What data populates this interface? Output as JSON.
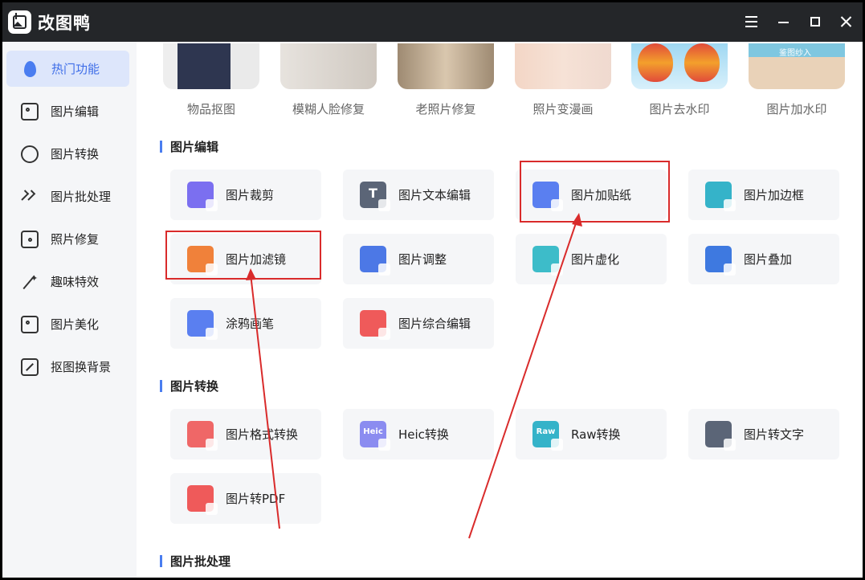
{
  "window": {
    "title": "改图鸭"
  },
  "sidebar": {
    "items": [
      {
        "label": "热门功能",
        "icon": "flame-icon",
        "active": true
      },
      {
        "label": "图片编辑",
        "icon": "image-edit-icon"
      },
      {
        "label": "图片转换",
        "icon": "convert-icon"
      },
      {
        "label": "图片批处理",
        "icon": "batch-icon"
      },
      {
        "label": "照片修复",
        "icon": "photo-repair-icon"
      },
      {
        "label": "趣味特效",
        "icon": "magic-wand-icon"
      },
      {
        "label": "图片美化",
        "icon": "beautify-icon"
      },
      {
        "label": "抠图换背景",
        "icon": "cutout-icon"
      }
    ]
  },
  "featured": [
    {
      "label": "物品抠图"
    },
    {
      "label": "模糊人脸修复"
    },
    {
      "label": "老照片修复"
    },
    {
      "label": "照片变漫画"
    },
    {
      "label": "图片去水印"
    },
    {
      "label": "图片加水印",
      "watermark": "鉴图纱入"
    }
  ],
  "sections": {
    "edit": {
      "title": "图片编辑",
      "cards": [
        {
          "label": "图片裁剪",
          "icon": "crop-icon",
          "color": "#7b6ff0"
        },
        {
          "label": "图片文本编辑",
          "icon": "text-edit-icon",
          "color": "#5b6577"
        },
        {
          "label": "图片加贴纸",
          "icon": "sticker-icon",
          "color": "#5a7ff0",
          "highlighted": true
        },
        {
          "label": "图片加边框",
          "icon": "border-icon",
          "color": "#35b3c9"
        },
        {
          "label": "图片加滤镜",
          "icon": "filter-icon",
          "color": "#f0813a",
          "highlighted": true
        },
        {
          "label": "图片调整",
          "icon": "adjust-icon",
          "color": "#4c78e6"
        },
        {
          "label": "图片虚化",
          "icon": "blur-icon",
          "color": "#3dbcc9"
        },
        {
          "label": "图片叠加",
          "icon": "layers-icon",
          "color": "#3e79e0"
        },
        {
          "label": "涂鸦画笔",
          "icon": "brush-icon",
          "color": "#5a7ff0"
        },
        {
          "label": "图片综合编辑",
          "icon": "comprehensive-edit-icon",
          "color": "#ef5a5a"
        }
      ]
    },
    "convert": {
      "title": "图片转换",
      "cards": [
        {
          "label": "图片格式转换",
          "icon": "format-convert-icon",
          "color": "#ef6767"
        },
        {
          "label": "Heic转换",
          "icon": "heic-icon",
          "color": "#8b8cf0",
          "glyph": "Heic"
        },
        {
          "label": "Raw转换",
          "icon": "raw-icon",
          "color": "#35b3c9",
          "glyph": "Raw"
        },
        {
          "label": "图片转文字",
          "icon": "image-to-text-icon",
          "color": "#5b6577"
        },
        {
          "label": "图片转PDF",
          "icon": "pdf-icon",
          "color": "#ef5a5a"
        }
      ]
    },
    "batch": {
      "title": "图片批处理"
    }
  },
  "colors": {
    "accent": "#4a7df0",
    "annotation": "#d92b2b",
    "titlebar": "#242629"
  }
}
